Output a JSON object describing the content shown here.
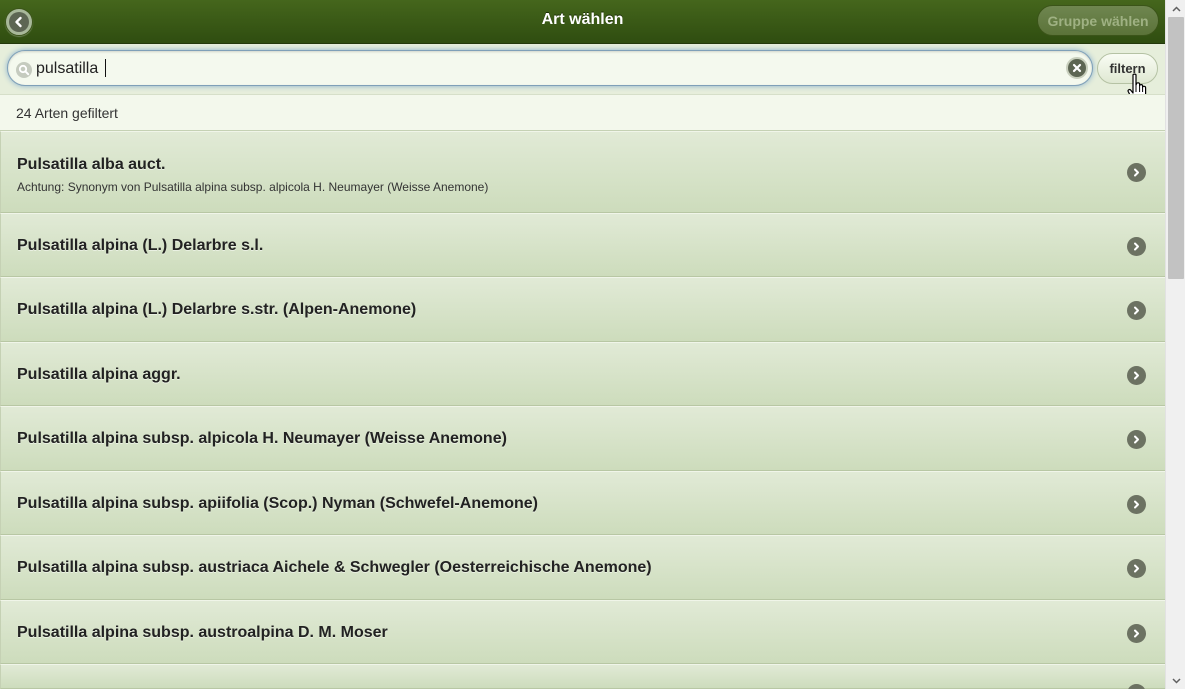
{
  "header": {
    "title": "Art wählen",
    "group_button": "Gruppe wählen"
  },
  "search": {
    "value": "pulsatilla",
    "filter_button": "filtern"
  },
  "result_count": "24 Arten gefiltert",
  "species": [
    {
      "name": "Pulsatilla alba auct.",
      "note": "Achtung: Synonym von Pulsatilla alpina subsp. alpicola H. Neumayer (Weisse Anemone)"
    },
    {
      "name": "Pulsatilla alpina (L.) Delarbre s.l."
    },
    {
      "name": "Pulsatilla alpina (L.) Delarbre s.str. (Alpen-Anemone)"
    },
    {
      "name": "Pulsatilla alpina aggr."
    },
    {
      "name": "Pulsatilla alpina subsp. alpicola H. Neumayer (Weisse Anemone)"
    },
    {
      "name": "Pulsatilla alpina subsp. apiifolia (Scop.) Nyman (Schwefel-Anemone)"
    },
    {
      "name": "Pulsatilla alpina subsp. austriaca Aichele & Schwegler (Oesterreichische Anemone)"
    },
    {
      "name": "Pulsatilla alpina subsp. austroalpina D. M. Moser"
    },
    {
      "name": ""
    }
  ],
  "icons": {
    "back": "back-arrow-icon",
    "search": "search-icon",
    "clear": "clear-icon",
    "chevron": "chevron-right-icon"
  },
  "colors": {
    "header": "#3a5915",
    "row": "#d7e3c9",
    "accent_focus": "#86aecd"
  }
}
